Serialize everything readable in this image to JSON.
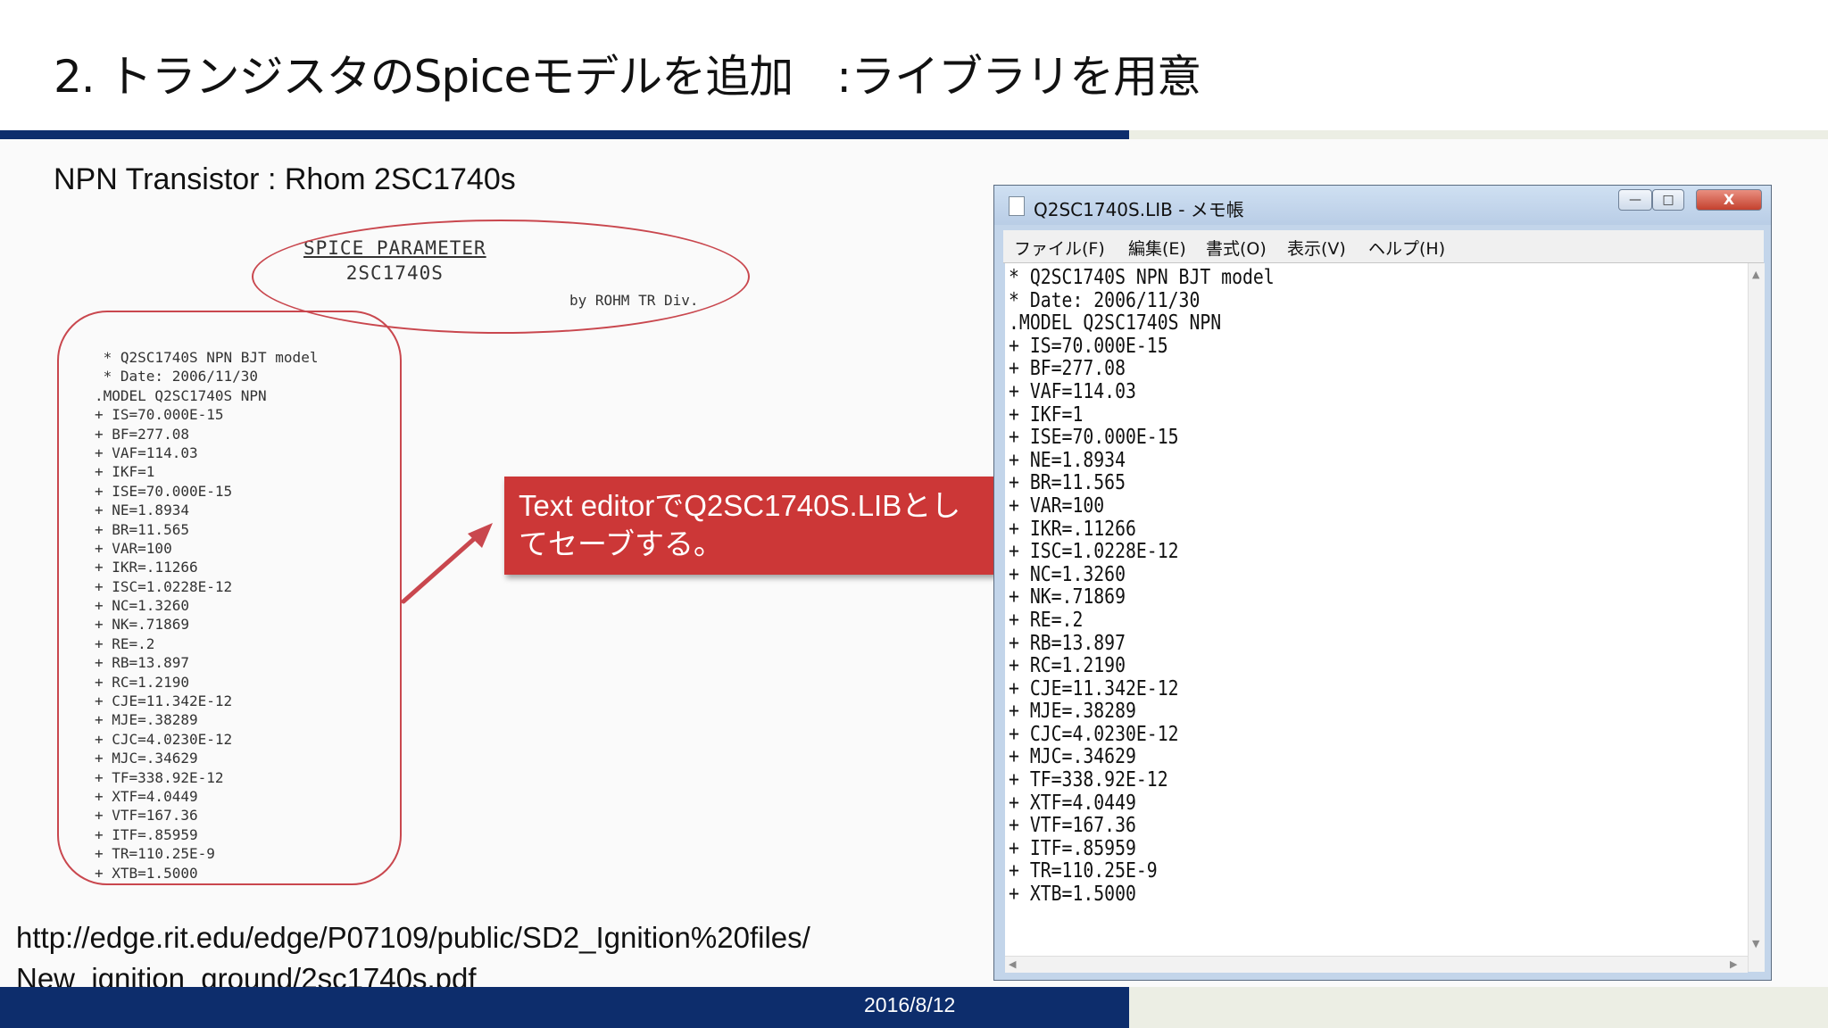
{
  "slide": {
    "title": "2. トランジスタのSpiceモデルを追加　:ライブラリを用意",
    "subtitle": "NPN Transistor : Rhom 2SC1740s",
    "source_url_line1": "http://edge.rit.edu/edge/P07109/public/SD2_Ignition%20files/",
    "source_url_line2": "New_ignition_ground/2sc1740s.pdf",
    "footer_date": "2016/8/12"
  },
  "scan": {
    "heading": "SPICE PARAMETER",
    "part": "2SC1740S",
    "by": "by ROHM TR Div.",
    "lines": [
      " * Q2SC1740S NPN BJT model",
      " * Date: 2006/11/30",
      ".MODEL Q2SC1740S NPN",
      "+ IS=70.000E-15",
      "+ BF=277.08",
      "+ VAF=114.03",
      "+ IKF=1",
      "+ ISE=70.000E-15",
      "+ NE=1.8934",
      "+ BR=11.565",
      "+ VAR=100",
      "+ IKR=.11266",
      "+ ISC=1.0228E-12",
      "+ NC=1.3260",
      "+ NK=.71869",
      "+ RE=.2",
      "+ RB=13.897",
      "+ RC=1.2190",
      "+ CJE=11.342E-12",
      "+ MJE=.38289",
      "+ CJC=4.0230E-12",
      "+ MJC=.34629",
      "+ TF=338.92E-12",
      "+ XTF=4.0449",
      "+ VTF=167.36",
      "+ ITF=.85959",
      "+ TR=110.25E-9",
      "+ XTB=1.5000"
    ]
  },
  "callout": {
    "line1": "Text editorでQ2SC1740S.LIBとし",
    "line2": "てセーブする。"
  },
  "notepad": {
    "title": "Q2SC1740S.LIB - メモ帳",
    "controls": {
      "minimize": "—",
      "maximize": "□",
      "close": "X"
    },
    "menu": [
      "ファイル(F)",
      "編集(E)",
      "書式(O)",
      "表示(V)",
      "ヘルプ(H)"
    ],
    "lines": [
      "* Q2SC1740S NPN BJT model",
      "* Date: 2006/11/30",
      ".MODEL Q2SC1740S NPN",
      "+ IS=70.000E-15",
      "+ BF=277.08",
      "+ VAF=114.03",
      "+ IKF=1",
      "+ ISE=70.000E-15",
      "+ NE=1.8934",
      "+ BR=11.565",
      "+ VAR=100",
      "+ IKR=.11266",
      "+ ISC=1.0228E-12",
      "+ NC=1.3260",
      "+ NK=.71869",
      "+ RE=.2",
      "+ RB=13.897",
      "+ RC=1.2190",
      "+ CJE=11.342E-12",
      "+ MJE=.38289",
      "+ CJC=4.0230E-12",
      "+ MJC=.34629",
      "+ TF=338.92E-12",
      "+ XTF=4.0449",
      "+ VTF=167.36",
      "+ ITF=.85959",
      "+ TR=110.25E-9",
      "+ XTB=1.5000"
    ],
    "scroll_up": "▲",
    "scroll_down": "▼",
    "scroll_left": "◀",
    "scroll_right": "▶"
  },
  "colors": {
    "brand_blue": "#0d2d6c",
    "callout_red": "#cc3737",
    "annotation_red": "#c9474e"
  }
}
